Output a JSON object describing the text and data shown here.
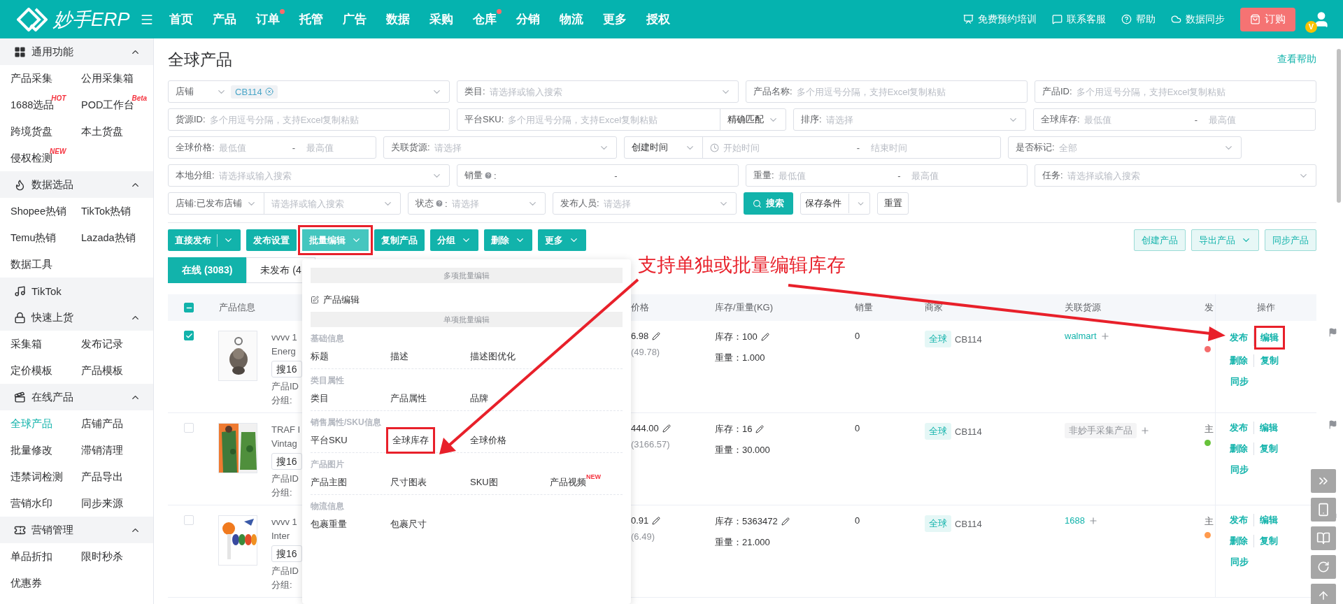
{
  "top_bar": {
    "logo": "妙手ERP",
    "nav": [
      {
        "label": "首页",
        "dot": false
      },
      {
        "label": "产品",
        "dot": false
      },
      {
        "label": "订单",
        "dot": true
      },
      {
        "label": "托管",
        "dot": false
      },
      {
        "label": "广告",
        "dot": false
      },
      {
        "label": "数据",
        "dot": false
      },
      {
        "label": "采购",
        "dot": false
      },
      {
        "label": "仓库",
        "dot": true
      },
      {
        "label": "分销",
        "dot": false
      },
      {
        "label": "物流",
        "dot": false
      },
      {
        "label": "更多",
        "dot": false
      },
      {
        "label": "授权",
        "dot": false
      }
    ],
    "links": [
      {
        "label": "免费预约培训",
        "kind": "training"
      },
      {
        "label": "联系客服",
        "kind": "chat"
      },
      {
        "label": "帮助",
        "kind": "help"
      },
      {
        "label": "数据同步",
        "kind": "sync"
      }
    ],
    "order_button": "订购",
    "avatar_badge": "V"
  },
  "sidebar": [
    {
      "title": "通用功能",
      "expanded": true,
      "items": [
        {
          "label": "产品采集",
          "selected": false
        },
        {
          "label": "公用采集箱",
          "selected": false
        },
        {
          "label": "1688选品",
          "badge": "HOT",
          "selected": false
        },
        {
          "label": "POD工作台",
          "badge": "Beta",
          "selected": false
        },
        {
          "label": "跨境货盘",
          "selected": false
        },
        {
          "label": "本土货盘",
          "selected": false
        },
        {
          "label": "侵权检测",
          "badge": "NEW",
          "selected": false
        }
      ]
    },
    {
      "title": "数据选品",
      "expanded": true,
      "items": [
        {
          "label": "Shopee热销",
          "selected": false
        },
        {
          "label": "TikTok热销",
          "selected": false
        },
        {
          "label": "Temu热销",
          "selected": false
        },
        {
          "label": "Lazada热销",
          "selected": false
        },
        {
          "label": "数据工具",
          "selected": false
        }
      ]
    },
    {
      "title": "TikTok"
    },
    {
      "title": "快速上货",
      "expanded": true,
      "items": [
        {
          "label": "采集箱",
          "selected": false
        },
        {
          "label": "发布记录",
          "selected": false
        },
        {
          "label": "定价模板",
          "selected": false
        },
        {
          "label": "产品模板",
          "selected": false
        }
      ]
    },
    {
      "title": "在线产品",
      "expanded": true,
      "items": [
        {
          "label": "全球产品",
          "selected": true
        },
        {
          "label": "店铺产品",
          "selected": false
        },
        {
          "label": "批量修改",
          "selected": false
        },
        {
          "label": "滞销清理",
          "selected": false
        },
        {
          "label": "违禁词检测",
          "selected": false
        },
        {
          "label": "产品导出",
          "selected": false
        },
        {
          "label": "营销水印",
          "selected": false
        },
        {
          "label": "同步来源",
          "selected": false
        }
      ]
    },
    {
      "title": "营销管理",
      "expanded": true,
      "items": [
        {
          "label": "单品折扣",
          "selected": false
        },
        {
          "label": "限时秒杀",
          "selected": false
        },
        {
          "label": "优惠券",
          "selected": false
        }
      ]
    }
  ],
  "page": {
    "title": "全球产品",
    "help_link": "查看帮助"
  },
  "filters": [
    [
      {
        "kind": "tag_select",
        "label": "店铺",
        "tag": "CB114"
      },
      {
        "kind": "select",
        "label": "类目:",
        "placeholder": "请选择或输入搜索"
      },
      {
        "kind": "input",
        "label": "产品名称:",
        "placeholder": "多个用逗号分隔，支持Excel复制粘贴"
      },
      {
        "kind": "input",
        "label": "产品ID:",
        "placeholder": "多个用逗号分隔，支持Excel复制粘贴"
      }
    ],
    [
      {
        "kind": "input",
        "label": "货源ID:",
        "placeholder": "多个用逗号分隔，支持Excel复制粘贴"
      },
      {
        "kind": "input_select",
        "label": "平台SKU:",
        "placeholder": "多个用逗号分隔，支持Excel复制粘贴",
        "option": "精确匹配"
      },
      {
        "kind": "select",
        "label": "排序:",
        "placeholder": "请选择"
      },
      {
        "kind": "range",
        "label": "全球库存:",
        "from": {
          "placeholder": "最低值"
        },
        "separator": "-",
        "to": {
          "placeholder": "最高值"
        }
      }
    ],
    [
      {
        "kind": "range",
        "label": "全球价格:",
        "from": {
          "placeholder": "最低值"
        },
        "separator": "-",
        "to": {
          "placeholder": "最高值"
        }
      },
      {
        "kind": "select",
        "label": "关联货源:",
        "placeholder": "请选择"
      },
      {
        "kind": "date_range",
        "option": "创建时间",
        "from": {
          "placeholder": "开始时间"
        },
        "separator": "-",
        "to": {
          "placeholder": "结束时间"
        }
      },
      {
        "kind": "select",
        "label": "是否标记:",
        "placeholder": "全部"
      }
    ],
    [
      {
        "kind": "select",
        "label": "本地分组:",
        "placeholder": "请选择或输入搜索"
      },
      {
        "kind": "range",
        "label": "销量",
        "help": true,
        "suffix": ":",
        "separator": "-"
      },
      {
        "kind": "range",
        "label": "重量:",
        "from": {
          "placeholder": "最低值"
        },
        "separator": "-",
        "to": {
          "placeholder": "最高值"
        }
      },
      {
        "kind": "select",
        "label": "任务:",
        "placeholder": "请选择或输入搜索"
      }
    ],
    [
      {
        "kind": "double_select",
        "label": "店铺:",
        "value": "已发布店铺",
        "placeholder": "请选择或输入搜索"
      },
      {
        "kind": "select",
        "label": "状态",
        "help": true,
        "suffix": ":",
        "placeholder": "请选择"
      },
      {
        "kind": "select",
        "label": "发布人员:",
        "placeholder": "请选择"
      },
      {
        "kind": "search_button",
        "label": "搜索"
      },
      {
        "kind": "split_button",
        "label": "保存条件"
      },
      {
        "kind": "button",
        "label": "重置"
      }
    ]
  ],
  "toolbar": {
    "left": [
      {
        "label": "直接发布",
        "kind": "split",
        "open": false,
        "highlighted": false
      },
      {
        "label": "发布设置",
        "kind": "plain",
        "open": false,
        "highlighted": false
      },
      {
        "label": "批量编辑",
        "kind": "dropdown",
        "open": true,
        "highlighted": true
      },
      {
        "label": "复制产品",
        "kind": "plain",
        "open": false,
        "highlighted": false
      },
      {
        "label": "分组",
        "kind": "dropdown",
        "open": false,
        "highlighted": false
      },
      {
        "label": "删除",
        "kind": "dropdown",
        "open": false,
        "highlighted": false
      },
      {
        "label": "更多",
        "kind": "dropdown",
        "open": false,
        "highlighted": false
      }
    ],
    "right": [
      {
        "label": "创建产品",
        "kind": "plain"
      },
      {
        "label": "导出产品",
        "kind": "dropdown"
      },
      {
        "label": "同步产品",
        "kind": "plain"
      }
    ]
  },
  "tabs": [
    {
      "label": "在线 (3083)",
      "selected": true
    },
    {
      "label": "未发布 (4",
      "selected": false
    }
  ],
  "table": {
    "header_checkbox": {
      "checked": true,
      "indeterminate": true
    },
    "columns": [
      "产品信息",
      "价格",
      "库存/重量(KG)",
      "销量",
      "商家",
      "关联货源",
      "发",
      "操作"
    ],
    "rows": [
      {
        "checked": true,
        "title_lines": [
          "vvvv 1",
          "Energ"
        ],
        "tag": "搜16",
        "id_label": "产品ID",
        "group_label": "分组:",
        "price": "6.98",
        "price_sub": "(49.78)",
        "stock": "库存：100",
        "weight": "重量：1.000",
        "sales": "0",
        "merchant_tag": "全球",
        "merchant": "CB114",
        "source": {
          "kind": "link",
          "label": "walmart"
        },
        "status": {
          "color": "#f56c6c"
        },
        "actions": [
          {
            "label": "发布",
            "highlighted": false
          },
          {
            "label": "编辑",
            "highlighted": true
          },
          {
            "label": "删除",
            "highlighted": false
          },
          {
            "label": "复制",
            "highlighted": false
          },
          {
            "label": "同步",
            "highlighted": false
          }
        ]
      },
      {
        "checked": false,
        "title_lines": [
          "TRAF I",
          "Vintag"
        ],
        "tag": "搜16",
        "id_label": "产品ID",
        "group_label": "分组:",
        "price": "444.00",
        "price_sub": "(3166.57)",
        "stock": "库存：16",
        "weight": "重量：30.000",
        "sales": "0",
        "merchant_tag": "全球",
        "merchant": "CB114",
        "source": {
          "kind": "tag",
          "label": "非妙手采集产品"
        },
        "status": {
          "label": "主",
          "color": "#67c23a"
        },
        "actions": [
          {
            "label": "发布",
            "highlighted": false
          },
          {
            "label": "编辑",
            "highlighted": false
          },
          {
            "label": "删除",
            "highlighted": false
          },
          {
            "label": "复制",
            "highlighted": false
          },
          {
            "label": "同步",
            "highlighted": false
          }
        ]
      },
      {
        "checked": false,
        "title_lines": [
          "vvvv 1",
          "Inter"
        ],
        "tag": "搜16",
        "id_label": "产品ID",
        "group_label": "分组:",
        "price": "0.91",
        "price_sub": "(6.49)",
        "stock": "库存：5363472",
        "weight": "重量：21.000",
        "sales": "0",
        "merchant_tag": "全球",
        "merchant": "CB114",
        "source": {
          "kind": "link",
          "label": "1688"
        },
        "status": {
          "label": "主",
          "color": "#ff9a4d"
        },
        "actions": [
          {
            "label": "发布",
            "highlighted": false
          },
          {
            "label": "编辑",
            "highlighted": false
          },
          {
            "label": "删除",
            "highlighted": false
          },
          {
            "label": "复制",
            "highlighted": false
          },
          {
            "label": "同步",
            "highlighted": false
          }
        ]
      }
    ]
  },
  "batch_menu": {
    "sections": [
      {
        "header": "多项批量编辑",
        "groups": [
          {
            "items": [
              {
                "label": "产品编辑",
                "kind": "icon",
                "highlighted": false
              }
            ]
          }
        ]
      },
      {
        "header": "单项批量编辑",
        "groups": [
          {
            "title": "基础信息",
            "items": [
              {
                "label": "标题",
                "highlighted": false
              },
              {
                "label": "描述",
                "highlighted": false
              },
              {
                "label": "描述图优化",
                "highlighted": false
              }
            ]
          },
          {
            "title": "类目属性",
            "items": [
              {
                "label": "类目",
                "highlighted": false
              },
              {
                "label": "产品属性",
                "highlighted": false
              },
              {
                "label": "品牌",
                "highlighted": false
              }
            ]
          },
          {
            "title": "销售属性/SKU信息",
            "items": [
              {
                "label": "平台SKU",
                "highlighted": false
              },
              {
                "label": "全球库存",
                "highlighted": true
              },
              {
                "label": "全球价格",
                "highlighted": false
              }
            ]
          },
          {
            "title": "产品图片",
            "items": [
              {
                "label": "产品主图",
                "highlighted": false
              },
              {
                "label": "尺寸图表",
                "highlighted": false
              },
              {
                "label": "SKU图",
                "highlighted": false
              },
              {
                "label": "产品视频",
                "badge": "NEW",
                "highlighted": false
              }
            ]
          },
          {
            "title": "物流信息",
            "items": [
              {
                "label": "包裹重量",
                "highlighted": false
              },
              {
                "label": "包裹尺寸",
                "highlighted": false
              }
            ]
          }
        ]
      }
    ]
  },
  "annotation": {
    "text": "支持单独或批量编辑库存"
  }
}
